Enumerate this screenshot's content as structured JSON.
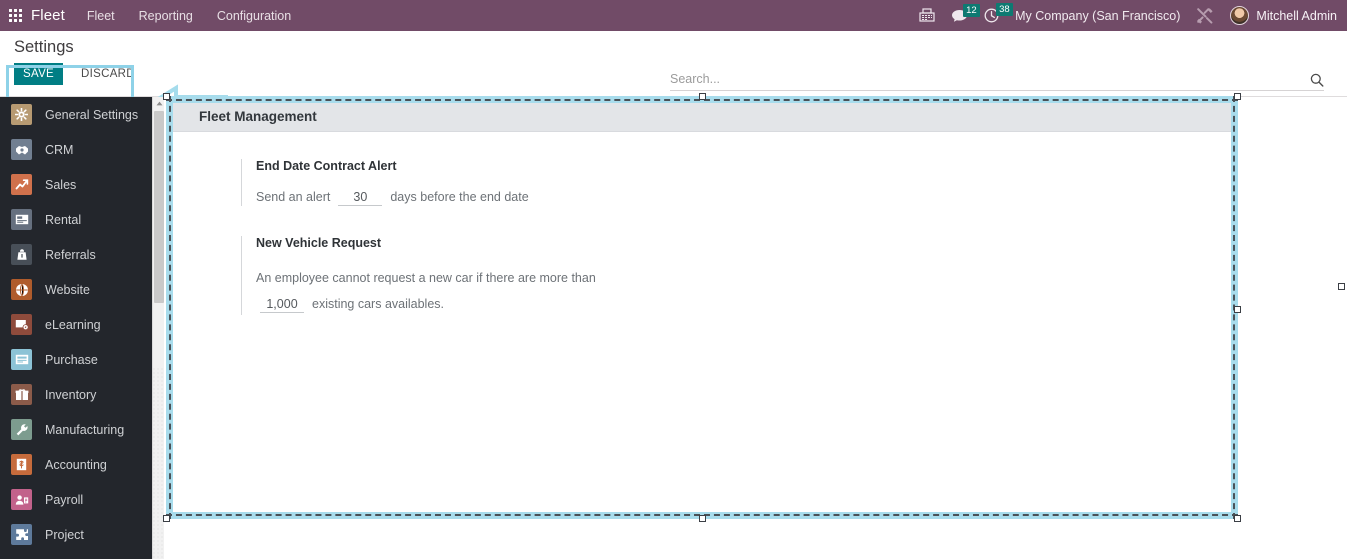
{
  "topbar": {
    "apps_icon": "apps-grid-icon",
    "brand": "Fleet",
    "menu": [
      {
        "label": "Fleet"
      },
      {
        "label": "Reporting"
      },
      {
        "label": "Configuration"
      }
    ],
    "icons": [
      {
        "name": "fax-icon",
        "badge": null
      },
      {
        "name": "messages-icon",
        "badge": "12"
      },
      {
        "name": "activities-clock-icon",
        "badge": "38"
      }
    ],
    "company": "My Company (San Francisco)",
    "tools_icon": "tools-icon",
    "user": "Mitchell Admin",
    "bar_color": "#714B67",
    "badge_color": "#0E7A72"
  },
  "controlpanel": {
    "title": "Settings",
    "save_label": "SAVE",
    "discard_label": "DISCARD",
    "save_color": "#017E84",
    "annotation_color": "#8ED2E8"
  },
  "search": {
    "placeholder": "Search...",
    "value": "",
    "icon": "search-icon"
  },
  "sidebar": {
    "items": [
      {
        "label": "General Settings",
        "icon": "gear-icon",
        "color": "#b79a72"
      },
      {
        "label": "CRM",
        "icon": "handshake-icon",
        "color": "#717f91"
      },
      {
        "label": "Sales",
        "icon": "chart-up-icon",
        "color": "#d0714c"
      },
      {
        "label": "Rental",
        "icon": "card-icon",
        "color": "#66707f"
      },
      {
        "label": "Referrals",
        "icon": "gift-bag-icon",
        "color": "#484f58"
      },
      {
        "label": "Website",
        "icon": "globe-icon",
        "color": "#b05c2c"
      },
      {
        "label": "eLearning",
        "icon": "presentation-icon",
        "color": "#8e4b3c"
      },
      {
        "label": "Purchase",
        "icon": "receipt-icon",
        "color": "#8cc3d6"
      },
      {
        "label": "Inventory",
        "icon": "box-icon",
        "color": "#8b5b4a"
      },
      {
        "label": "Manufacturing",
        "icon": "wrench-icon",
        "color": "#7d9c8f"
      },
      {
        "label": "Accounting",
        "icon": "invoice-icon",
        "color": "#c66b3c"
      },
      {
        "label": "Payroll",
        "icon": "employee-id-icon",
        "color": "#c2628b"
      },
      {
        "label": "Project",
        "icon": "puzzle-icon",
        "color": "#5e7a9b"
      }
    ],
    "bg_color": "#23262c"
  },
  "main": {
    "sheet_title": "Fleet Management",
    "blocks": [
      {
        "title": "End Date Contract Alert",
        "prefix": "Send an alert",
        "value": "30",
        "suffix": "days before the end date"
      },
      {
        "title": "New Vehicle Request",
        "line1": "An employee cannot request a new car if there are more than",
        "value": "1,000",
        "suffix": "existing cars availables."
      }
    ]
  },
  "selection": {
    "fill_color": "#A8DCEC",
    "dash_color": "#4a5157"
  }
}
